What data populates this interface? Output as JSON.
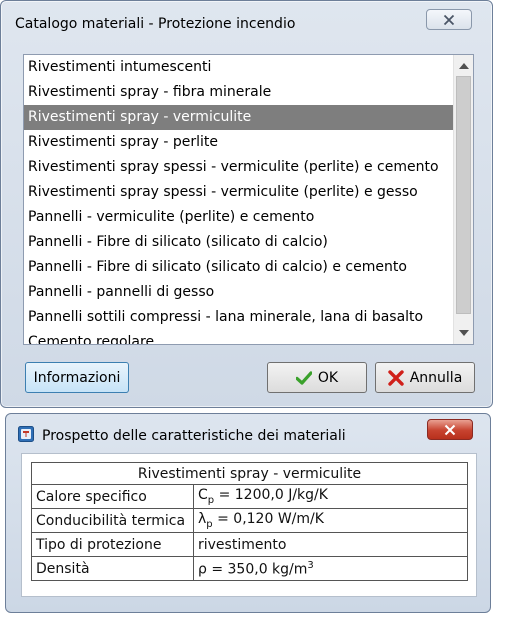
{
  "catalog_dialog": {
    "title": "Catalogo materiali  - Protezione incendio",
    "items": [
      "Rivestimenti intumescenti",
      "Rivestimenti spray  - fibra minerale",
      "Rivestimenti spray  - vermiculite",
      "Rivestimenti spray  - perlite",
      "Rivestimenti spray spessi  - vermiculite (perlite) e cemento",
      "Rivestimenti spray spessi  - vermiculite (perlite) e gesso",
      "Pannelli  - vermiculite (perlite) e cemento",
      "Pannelli  - Fibre di silicato (silicato di calcio)",
      "Pannelli  - Fibre di silicato (silicato di calcio) e cemento",
      "Pannelli  - pannelli di gesso",
      "Pannelli sottili compressi  - lana minerale, lana di basalto",
      "Cemento regolare"
    ],
    "selected_index": 2,
    "buttons": {
      "info": "Informazioni",
      "ok": "OK",
      "cancel": "Annulla"
    }
  },
  "properties_dialog": {
    "title": "Prospetto delle caratteristiche dei materiali",
    "material": "Rivestimenti spray - vermiculite",
    "rows": [
      {
        "label": "Calore specifico",
        "symbol": "C",
        "sub": "p",
        "value": " = 1200,0 J/kg/K"
      },
      {
        "label": "Conducibilità termica",
        "symbol": "λ",
        "sub": "p",
        "value": " = 0,120 W/m/K"
      },
      {
        "label": "Tipo di protezione",
        "value_text": "rivestimento"
      },
      {
        "label": "Densità",
        "symbol": "ρ",
        "value": " = 350,0 kg/m",
        "sup": "3"
      }
    ]
  },
  "colors": {
    "selection": "#7e7e7e",
    "ok_check": "#3aa12b",
    "cancel_x": "#d0201a",
    "close_red": "#c7432f"
  }
}
